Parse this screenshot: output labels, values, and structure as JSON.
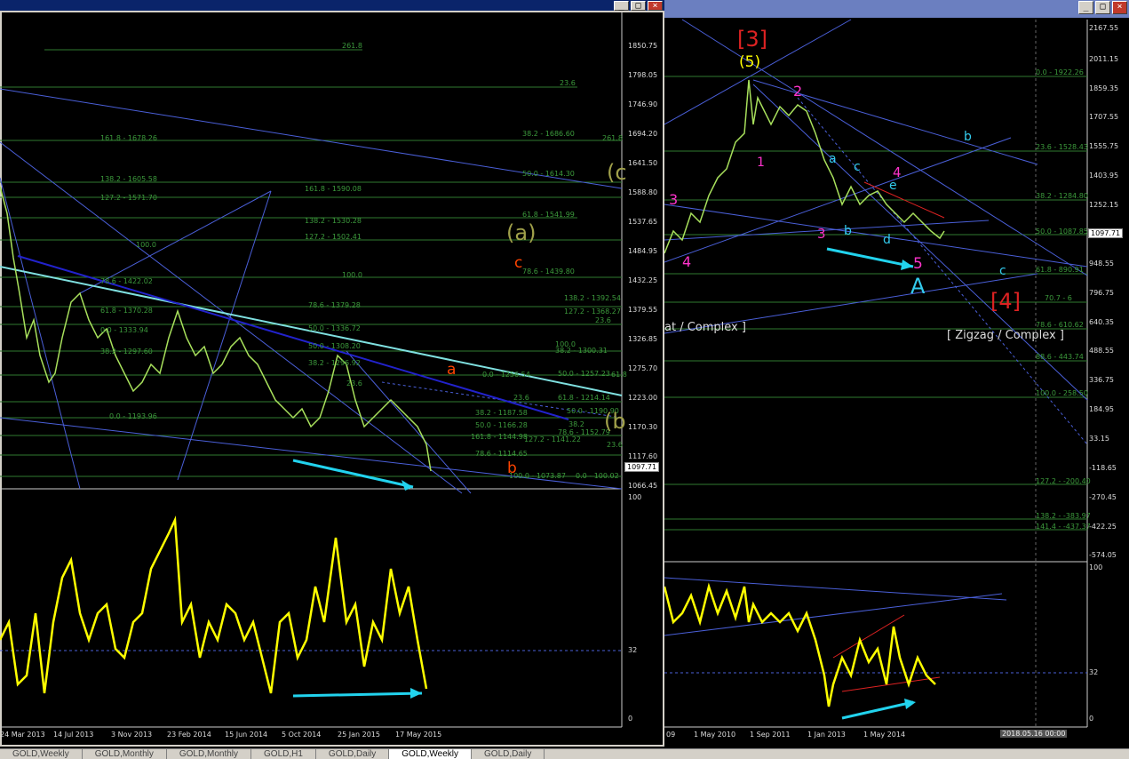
{
  "colors": {
    "bg": "#000000",
    "fib": "#3c9a3c",
    "trend": "#5b6fe0",
    "price": "#a8e05c",
    "osc": "#ffff00",
    "arrow": "#22d3ee",
    "magenta": "#ff33cc",
    "cyan": "#33ccee",
    "red": "#dd2222",
    "olive": "#a0a04a",
    "orange": "#ff4400"
  },
  "tabs": [
    "GOLD,Weekly",
    "GOLD,Monthly",
    "GOLD,Monthly",
    "GOLD,H1",
    "GOLD,Daily",
    "GOLD,Weekly",
    "GOLD,Daily"
  ],
  "active_tab": 5,
  "left_chart": {
    "y_axis": [
      "1850.75",
      "1798.05",
      "1746.90",
      "1694.20",
      "1641.50",
      "1588.80",
      "1537.65",
      "1484.95",
      "1432.25",
      "1379.55",
      "1326.85",
      "1275.70",
      "1223.00",
      "1170.30",
      "1117.60",
      "1066.45"
    ],
    "current_price": "1097.71",
    "x_axis": [
      "24 Mar 2013",
      "14 Jul 2013",
      "3 Nov 2013",
      "23 Feb 2014",
      "15 Jun 2014",
      "5 Oct 2014",
      "25 Jan 2015",
      "17 May 2015"
    ],
    "osc_axis": [
      "100",
      "32",
      "0"
    ],
    "waves": {
      "a_paren": "(a)",
      "b_paren": "(b",
      "c_paren": "(c",
      "c": "c",
      "a": "a",
      "b": "b"
    },
    "fib_labels": [
      "261.8",
      "23.6",
      "161.8 - 1678.26",
      "38.2 - 1686.60",
      "261.8",
      "50.0 - 1614.30",
      "138.2 - 1605.58",
      "161.8 - 1590.08",
      "127.2 - 1571.70",
      "61.8 - 1541.99",
      "138.2 - 1530.28",
      "127.2 - 1502.41",
      "100.0",
      "78.6 - 1439.80",
      "100.0",
      "78.6 - 1422.02",
      "138.2 - 1392.54",
      "78.6 - 1379.28",
      "61.8 - 1370.28",
      "127.2 - 1368.27",
      "23.6",
      "50.0 - 1336.72",
      "0.0 - 1333.94",
      "50.0 - 1308.20",
      "100.0",
      "38.2 - 1300.31",
      "38.2 - 1297.60",
      "38.2 - 1296.92",
      "0.0 - 1256.54",
      "50.0 - 1257.23",
      "23.6",
      "61.8",
      "61.8 - 1214.14",
      "23.6",
      "50.0 - 1190.90",
      "0.0 - 1193.96",
      "38.2 - 1187.58",
      "50.0 - 1166.28",
      "38.2",
      "78.6 - 1152.79",
      "161.8 - 1144.98",
      "127.2 - 1141.22",
      "23.6",
      "78.6 - 1114.65",
      "100.0 - 1073.87",
      "0.0 - 100.02"
    ]
  },
  "right_chart": {
    "y_axis": [
      "2167.55",
      "2011.15",
      "1859.35",
      "1707.55",
      "1555.75",
      "1403.95",
      "1252.15",
      "1097.71",
      "948.55",
      "796.75",
      "640.35",
      "488.55",
      "336.75",
      "184.95",
      "33.15",
      "-118.65",
      "-270.45",
      "-422.25",
      "-574.05"
    ],
    "current_price": "1097.71",
    "x_axis": [
      "09",
      "1 May 2010",
      "1 Sep 2011",
      "1 Jan 2013",
      "1 May 2014"
    ],
    "osc_axis": [
      "100",
      "32",
      "0"
    ],
    "date_box": "2018.05.16 00:00",
    "waves": {
      "w3_big": "[3]",
      "w5_paren": "(5)",
      "w1": "1",
      "w2": "2",
      "w3": "3",
      "w4": "4",
      "w5": "5",
      "w3b": "3",
      "w4b": "4",
      "wa": "a",
      "wb": "b",
      "wc": "c",
      "wd": "d",
      "we": "e",
      "wA": "A",
      "wb2": "b",
      "wc2": "c",
      "w4_big": "[4]"
    },
    "zigzag_left": "at / Complex ]",
    "zigzag_right": "[ Zigzag / Complex ]",
    "fib_labels": [
      "0.0 - 1922.26",
      "23.6 - 1528.43",
      "38.2 - 1284.80",
      "50.0 - 1087.85",
      "61.8 - 890.91",
      "70.7 - 6",
      "78.6 - 610.62",
      "88.6 - 443.74",
      "100.0 - 258.50",
      "127.2 - -200.40",
      "138.2 - -383.97",
      "141.4 - -437.37"
    ]
  }
}
